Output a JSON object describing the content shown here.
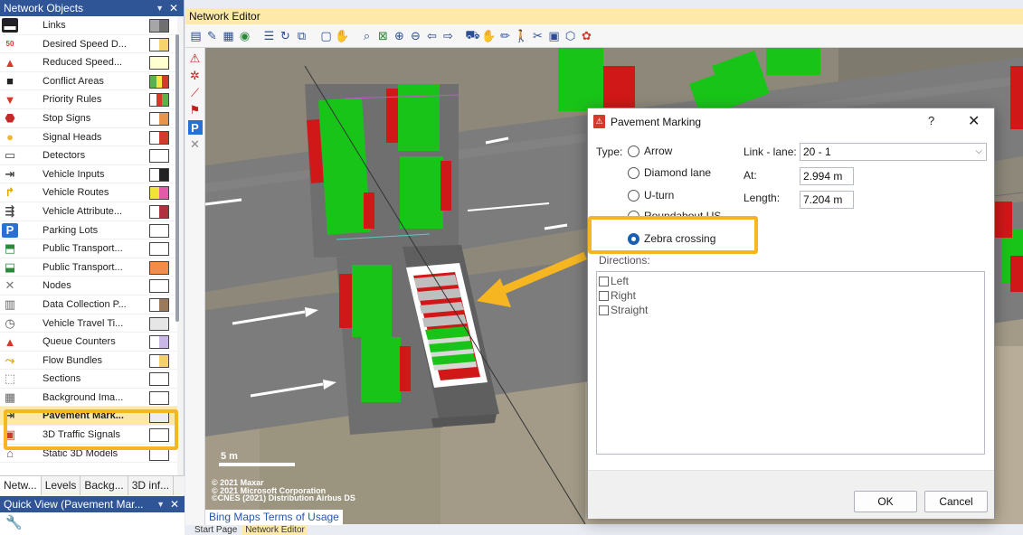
{
  "left_panel": {
    "title": "Network Objects",
    "items": [
      {
        "label": "Links",
        "icon": "links-icon",
        "swatch": [
          "#a6a6a6",
          "#6f6f6f"
        ]
      },
      {
        "label": "Desired Speed D...",
        "icon": "speed-50-icon",
        "swatch": [
          "#ffffff",
          "#f7d36b"
        ]
      },
      {
        "label": "Reduced Speed...",
        "icon": "warning-triangle-icon",
        "swatch": [
          "#ffffd0"
        ]
      },
      {
        "label": "Conflict Areas",
        "icon": "conflict-area-icon",
        "swatch": [
          "#5bb24a",
          "#ffe34a",
          "#d43a2b"
        ]
      },
      {
        "label": "Priority Rules",
        "icon": "priority-triangle-icon",
        "swatch": [
          "#ffffff",
          "#d43a2b",
          "#5bb24a"
        ]
      },
      {
        "label": "Stop Signs",
        "icon": "stop-sign-icon",
        "swatch": [
          "#ffffff",
          "#e8944a"
        ]
      },
      {
        "label": "Signal Heads",
        "icon": "signal-head-icon",
        "swatch": [
          "#ffffff",
          "#d43a2b"
        ]
      },
      {
        "label": "Detectors",
        "icon": "detector-icon",
        "swatch": [
          "#ffffff"
        ]
      },
      {
        "label": "Vehicle Inputs",
        "icon": "vehicle-input-icon",
        "swatch": [
          "#ffffff",
          "#222222"
        ]
      },
      {
        "label": "Vehicle Routes",
        "icon": "vehicle-route-icon",
        "swatch": [
          "#f2e338",
          "#e35aa9"
        ]
      },
      {
        "label": "Vehicle Attribute...",
        "icon": "vehicle-attribute-icon",
        "swatch": [
          "#ffffff",
          "#b03040"
        ]
      },
      {
        "label": "Parking Lots",
        "icon": "parking-icon",
        "swatch": [
          "#ffffff"
        ]
      },
      {
        "label": "Public Transport...",
        "icon": "public-transport-stop-icon",
        "swatch": [
          "#ffffff"
        ]
      },
      {
        "label": "Public Transport...",
        "icon": "public-transport-line-icon",
        "swatch": [
          "#f28c4a"
        ]
      },
      {
        "label": "Nodes",
        "icon": "nodes-icon",
        "swatch": [
          "#ffffff"
        ]
      },
      {
        "label": "Data Collection P...",
        "icon": "data-collection-icon",
        "swatch": [
          "#ffffff",
          "#9a7a5a"
        ]
      },
      {
        "label": "Vehicle Travel Ti...",
        "icon": "travel-time-icon",
        "swatch": [
          "#e6e6e6"
        ]
      },
      {
        "label": "Queue Counters",
        "icon": "queue-counter-icon",
        "swatch": [
          "#ffffff",
          "#c9b8e6"
        ]
      },
      {
        "label": "Flow Bundles",
        "icon": "flow-bundle-icon",
        "swatch": [
          "#ffffff",
          "#f2d16b"
        ]
      },
      {
        "label": "Sections",
        "icon": "sections-icon",
        "swatch": [
          "#ffffff"
        ]
      },
      {
        "label": "Background Ima...",
        "icon": "background-image-icon",
        "swatch": [
          "#ffffff"
        ]
      },
      {
        "label": "Pavement Mark...",
        "icon": "pavement-marking-icon",
        "swatch": [
          "#ececec"
        ],
        "selected": true
      },
      {
        "label": "3D Traffic Signals",
        "icon": "traffic-signal-3d-icon",
        "swatch": [
          "#ffffff"
        ]
      },
      {
        "label": "Static 3D Models",
        "icon": "static-3d-model-icon",
        "swatch": [
          "#ffffff"
        ]
      }
    ],
    "tabs": [
      "Netw...",
      "Levels",
      "Backg...",
      "3D inf..."
    ]
  },
  "quick_view": {
    "title": "Quick View (Pavement Mar..."
  },
  "editor": {
    "title": "Network Editor",
    "toolbar_icons": [
      "select-mode-icon",
      "network-settings-icon",
      "grid-icon",
      "globe-icon",
      "list-icon",
      "rotate-icon",
      "copy-icon",
      "paste-icon",
      "pan-hand-icon",
      "zoom-region-icon",
      "zoom-extent-icon",
      "zoom-in-icon",
      "zoom-out-icon",
      "back-icon",
      "forward-icon",
      "vehicle-icon",
      "hand-icon",
      "pencil-icon",
      "pedestrian-icon",
      "tools-icon",
      "camera-icon",
      "3d-icon",
      "palette-icon"
    ],
    "side_icons": [
      "warning-sign-icon",
      "pedestrian-area-icon",
      "ramp-icon",
      "pedestrian-route-icon",
      "parking-sign-icon",
      "crossing-icon"
    ],
    "scale_label": "5 m",
    "copyright": [
      "© 2021 Maxar",
      "© 2021 Microsoft Corporation",
      "©CNES (2021) Distribution Airbus DS"
    ],
    "bing_link": "Bing Maps Terms of Usage",
    "bottom_tabs": [
      "Start Page",
      "Network Editor"
    ]
  },
  "dialog": {
    "title": "Pavement Marking",
    "help": "?",
    "close": "✕",
    "type_label": "Type:",
    "types": [
      {
        "label": "Arrow",
        "checked": false
      },
      {
        "label": "Diamond lane",
        "checked": false
      },
      {
        "label": "U-turn",
        "checked": false
      },
      {
        "label": "Roundabout US",
        "checked": false
      },
      {
        "label": "Zebra crossing",
        "checked": true
      }
    ],
    "link_lane_label": "Link - lane:",
    "link_lane_value": "20 - 1",
    "at_label": "At:",
    "at_value": "2.994 m",
    "length_label": "Length:",
    "length_value": "7.204 m",
    "directions_label": "Directions:",
    "directions": [
      "Left",
      "Right",
      "Straight"
    ],
    "ok": "OK",
    "cancel": "Cancel"
  },
  "annotation": {
    "highlight_color": "#f5b622"
  }
}
